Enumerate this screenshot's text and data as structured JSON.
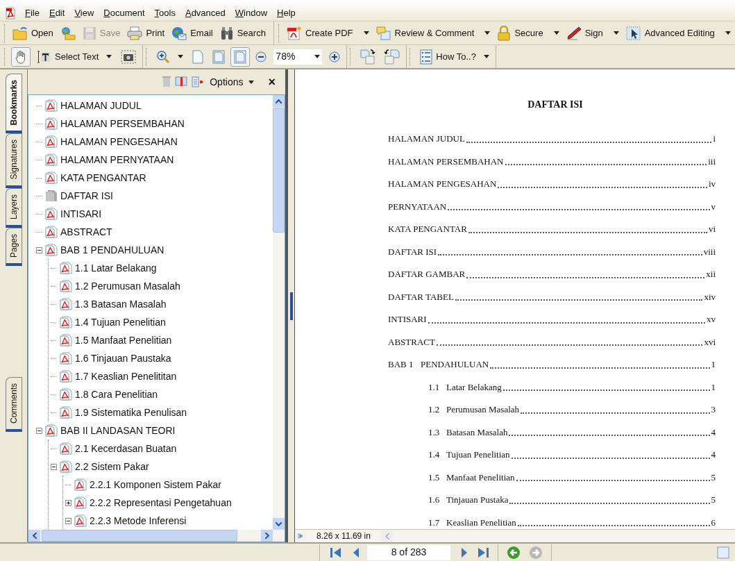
{
  "menu": [
    "File",
    "Edit",
    "View",
    "Document",
    "Tools",
    "Advanced",
    "Window",
    "Help"
  ],
  "toolbar": [
    [
      {
        "label": "Open",
        "disabled": false,
        "dropdown": false
      },
      {
        "disabled": false,
        "dropdown": false
      },
      {
        "label": "Save",
        "disabled": true,
        "dropdown": false
      },
      {
        "label": "Print",
        "disabled": false,
        "dropdown": false
      },
      {
        "label": "Email",
        "disabled": false,
        "dropdown": false
      },
      {
        "label": "Search",
        "disabled": false,
        "dropdown": false
      }
    ],
    [
      {
        "label": "Create PDF",
        "disabled": false,
        "dropdown": true
      },
      {
        "label": "Review & Comment",
        "disabled": false,
        "dropdown": true
      },
      {
        "label": "Secure",
        "disabled": false,
        "dropdown": true
      },
      {
        "label": "Sign",
        "disabled": false,
        "dropdown": true
      },
      {
        "label": "Advanced Editing",
        "disabled": false,
        "dropdown": true
      }
    ]
  ],
  "toolbar2": [
    [
      {
        "kind": "button",
        "selected": true,
        "dropdown": false
      },
      {
        "kind": "button",
        "label": "Select Text",
        "selected": false,
        "dropdown": true
      },
      {
        "kind": "button",
        "selected": false,
        "dropdown": false
      }
    ],
    [
      {
        "kind": "button",
        "selected": false,
        "dropdown": true
      },
      {
        "kind": "button",
        "selected": false,
        "dropdown": false
      },
      {
        "kind": "button",
        "selected": false,
        "dropdown": false
      },
      {
        "kind": "button",
        "selected": true,
        "dropdown": false
      },
      {
        "kind": "button",
        "selected": false,
        "dropdown": false
      },
      {
        "kind": "field",
        "value": "78%",
        "dropdown": true
      },
      {
        "kind": "button",
        "selected": false,
        "dropdown": false
      }
    ],
    [
      {
        "kind": "button",
        "selected": false,
        "dropdown": false
      },
      {
        "kind": "button",
        "selected": false,
        "dropdown": false
      }
    ],
    [
      {
        "kind": "button",
        "label": "How To..?",
        "selected": false,
        "dropdown": true
      }
    ]
  ],
  "side_tabs": [
    {
      "label": "Bookmarks",
      "selected": true
    },
    {
      "label": "Signatures",
      "selected": false
    },
    {
      "label": "Layers",
      "selected": false
    },
    {
      "label": "Pages",
      "selected": false
    },
    {
      "label": "Comments",
      "selected": false
    }
  ],
  "bookmarks_panel": {
    "options": "Options",
    "close": "×",
    "items": [
      {
        "label": "HALAMAN JUDUL",
        "kind": "pdf"
      },
      {
        "label": "HALAMAN PERSEMBAHAN",
        "kind": "pdf"
      },
      {
        "label": "HALAMAN PENGESAHAN",
        "kind": "pdf"
      },
      {
        "label": "HALAMAN PERNYATAAN",
        "kind": "pdf"
      },
      {
        "label": "KATA PENGANTAR",
        "kind": "pdf"
      },
      {
        "label": "DAFTAR ISI",
        "kind": "page"
      },
      {
        "label": "INTISARI",
        "kind": "pdf"
      },
      {
        "label": "ABSTRACT",
        "kind": "pdf"
      },
      {
        "label": "BAB 1 PENDAHULUAN",
        "kind": "pdf",
        "expanded": true,
        "children": [
          {
            "label": "1.1 Latar Belakang",
            "kind": "pdf"
          },
          {
            "label": "1.2 Perumusan Masalah",
            "kind": "pdf"
          },
          {
            "label": "1.3 Batasan Masalah",
            "kind": "pdf"
          },
          {
            "label": "1.4 Tujuan Penelitian",
            "kind": "pdf"
          },
          {
            "label": "1.5 Manfaat Penelitian",
            "kind": "pdf"
          },
          {
            "label": "1.6 Tinjauan Paustaka",
            "kind": "pdf"
          },
          {
            "label": "1.7 Keaslian Penelititan",
            "kind": "pdf"
          },
          {
            "label": "1.8 Cara Penelitian",
            "kind": "pdf"
          },
          {
            "label": "1.9 Sistematika Penulisan",
            "kind": "pdf"
          }
        ]
      },
      {
        "label": "BAB II LANDASAN TEORI",
        "kind": "pdf",
        "expanded": true,
        "children": [
          {
            "label": "2.1 Kecerdasan Buatan",
            "kind": "pdf"
          },
          {
            "label": "2.2 Sistem Pakar",
            "kind": "pdf",
            "expanded": true,
            "children": [
              {
                "label": "2.2.1 Komponen Sistem Pakar",
                "kind": "pdf"
              },
              {
                "label": "2.2.2 Representasi Pengetahuan",
                "kind": "pdf",
                "expanded": false
              },
              {
                "label": "2.2.3 Metode Inferensi",
                "kind": "pdf",
                "expanded": true
              }
            ]
          }
        ]
      }
    ]
  },
  "document": {
    "title": "DAFTAR ISI",
    "size": "8.26 x 11.69 in",
    "toc": [
      {
        "title": "HALAMAN JUDUL",
        "page": "i"
      },
      {
        "title": "HALAMAN PERSEMBAHAN",
        "page": "iii"
      },
      {
        "title": "HALAMAN PENGESAHAN",
        "page": "iv"
      },
      {
        "title": "PERNYATAAN",
        "page": "v"
      },
      {
        "title": "KATA PENGANTAR",
        "page": "vi"
      },
      {
        "title": "DAFTAR ISI",
        "page": "viii"
      },
      {
        "title": "DAFTAR GAMBAR",
        "page": "xii"
      },
      {
        "title": "DAFTAR TABEL",
        "page": "xiv"
      },
      {
        "title": "INTISARI",
        "page": "xv"
      },
      {
        "title": "ABSTRACT",
        "page": "xvi"
      },
      {
        "number": "BAB 1",
        "title": "PENDAHULUAN",
        "page": "1",
        "children": [
          {
            "number": "1.1",
            "title": "Latar Belakang",
            "page": "1"
          },
          {
            "number": "1.2",
            "title": "Perumusan Masalah",
            "page": "3"
          },
          {
            "number": "1.3",
            "title": "Batasan Masalah",
            "page": "4"
          },
          {
            "number": "1.4",
            "title": "Tujuan Penelitian",
            "page": "4"
          },
          {
            "number": "1.5",
            "title": "Manfaat Penelitian",
            "page": "5"
          },
          {
            "number": "1.6",
            "title": "Tinjauan Pustaka",
            "page": "5"
          },
          {
            "number": "1.7",
            "title": "Keaslian Penelitian",
            "page": "6"
          }
        ]
      }
    ]
  },
  "navigation": {
    "page": "8 of 283",
    "back_enabled": true,
    "forward_enabled": false
  }
}
